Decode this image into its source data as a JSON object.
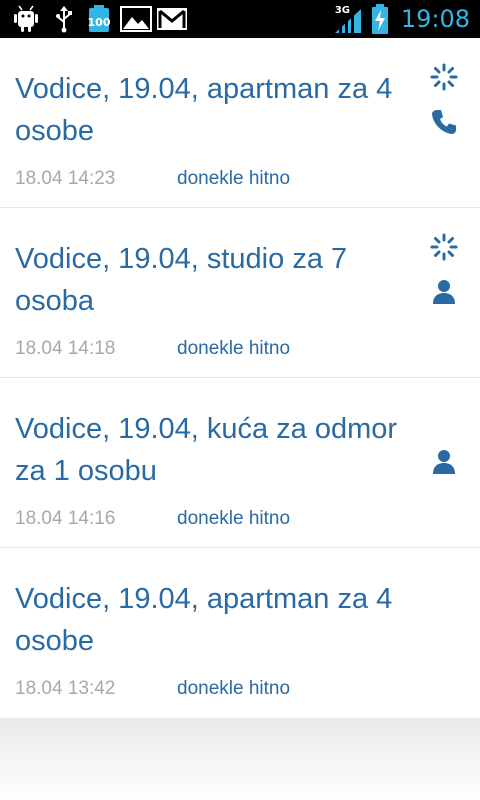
{
  "status_bar": {
    "icons_left": [
      "android-debug-icon",
      "usb-icon",
      "battery-100-notification-icon",
      "gallery-icon",
      "gmail-icon"
    ],
    "battery_notification_label": "100",
    "network_type": "3G",
    "time": "19:08"
  },
  "items": [
    {
      "title": "Vodice, 19.04, apartman za 4 osobe",
      "date": "18.04 14:23",
      "priority": "donekle hitno",
      "icons": [
        "loading-icon",
        "phone-icon"
      ]
    },
    {
      "title": "Vodice, 19.04, studio za 7 osoba",
      "date": "18.04 14:18",
      "priority": "donekle hitno",
      "icons": [
        "loading-icon",
        "person-icon"
      ]
    },
    {
      "title": "Vodice, 19.04, kuća za odmor za 1 osobu",
      "date": "18.04 14:16",
      "priority": "donekle hitno",
      "icons": [
        "person-icon"
      ]
    },
    {
      "title": "Vodice, 19.04, apartman za 4 osobe",
      "date": "18.04 13:42",
      "priority": "donekle hitno",
      "icons": []
    }
  ],
  "colors": {
    "accent": "#2a6aa3",
    "date_text": "#a8a8a8",
    "status_time": "#33b5e5"
  }
}
